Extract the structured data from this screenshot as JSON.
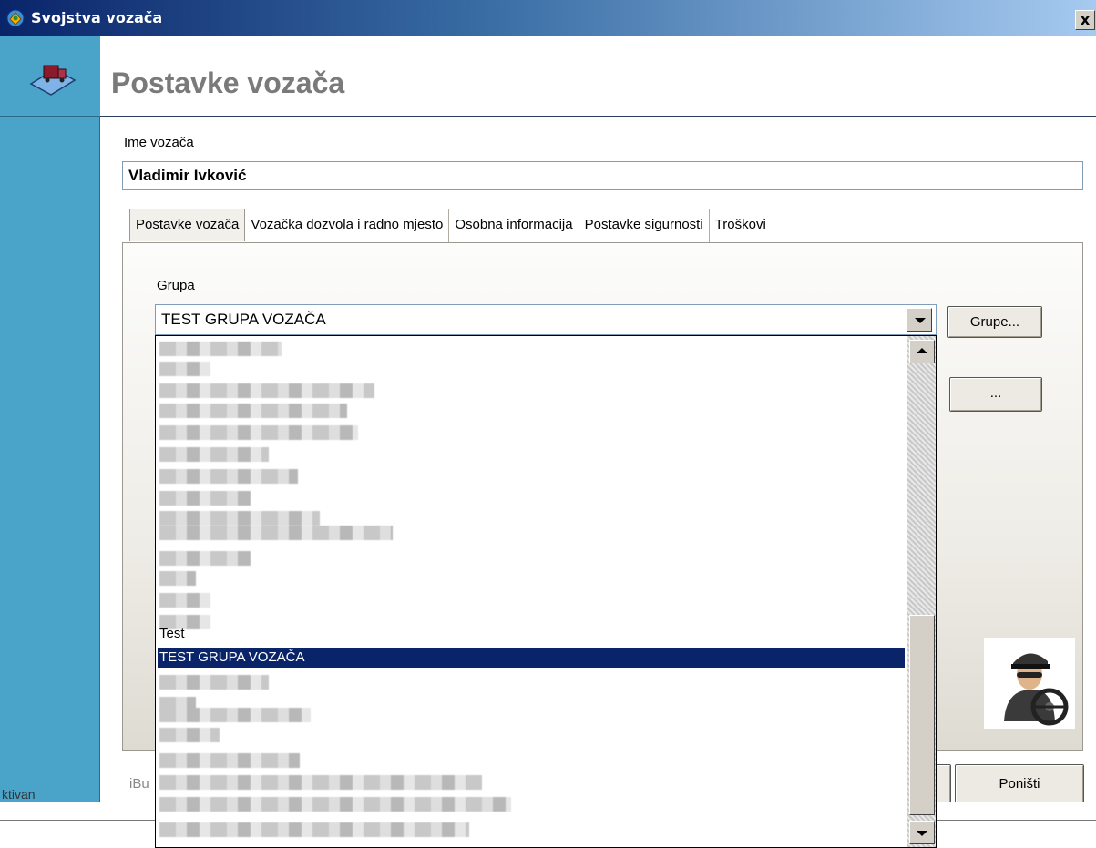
{
  "window": {
    "title": "Svojstva vozača",
    "close_label": "x"
  },
  "header": {
    "title": "Postavke vozača"
  },
  "driver": {
    "name_label": "Ime vozača",
    "name_value": "Vladimir Ivković"
  },
  "tabs": [
    {
      "label": "Postavke vozača",
      "active": true
    },
    {
      "label": "Vozačka dozvola i radno mjesto",
      "active": false
    },
    {
      "label": "Osobna informacija",
      "active": false
    },
    {
      "label": "Postavke sigurnosti",
      "active": false
    },
    {
      "label": "Troškovi",
      "active": false
    }
  ],
  "group": {
    "label": "Grupa",
    "selected_value": "TEST GRUPA VOZAČA",
    "groups_button_label": "Grupe...",
    "more_button_label": "..."
  },
  "dropdown": {
    "visible_items": [
      {
        "label": "Test",
        "selected": false
      },
      {
        "label": "TEST GRUPA VOZAČA",
        "selected": true
      }
    ]
  },
  "footer": {
    "partial_text": "iBu",
    "cancel_label": "Poništi",
    "status_partial": "ktivan"
  },
  "colors": {
    "titlebar_start": "#0a246a",
    "left_stripe": "#4aa3c9",
    "selection": "#0a246a"
  }
}
